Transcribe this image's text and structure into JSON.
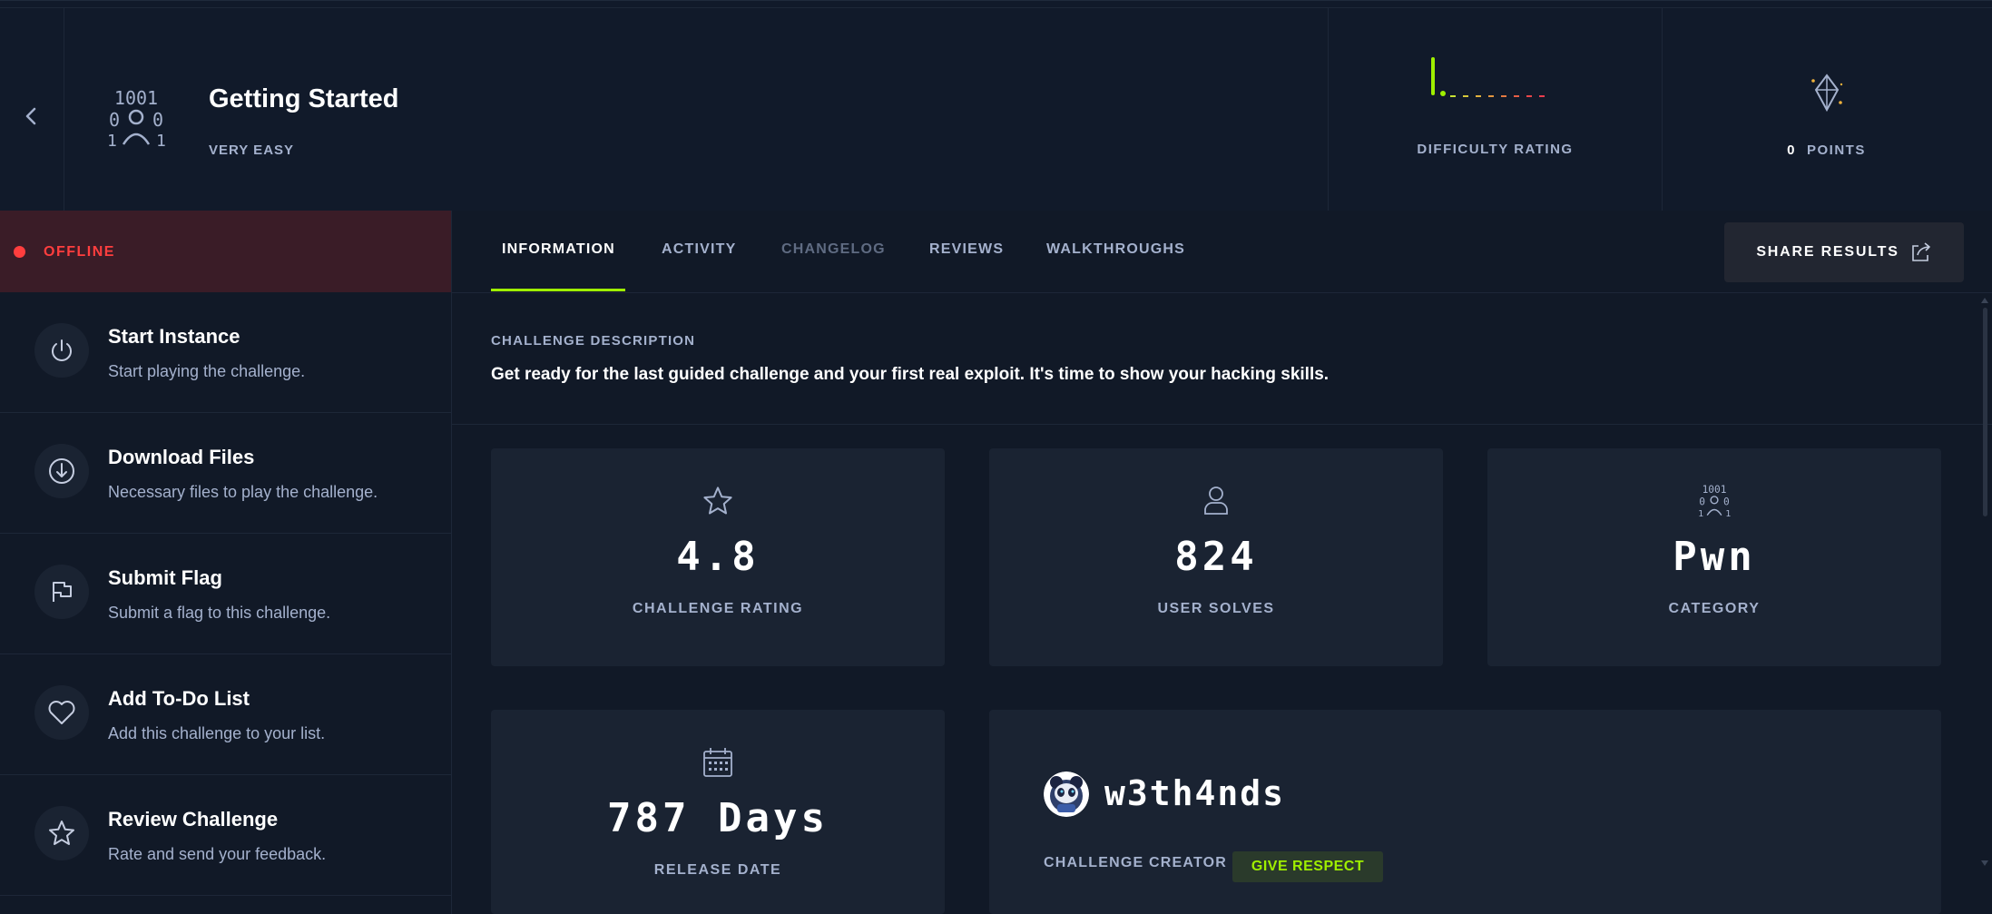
{
  "header": {
    "title": "Getting Started",
    "difficulty": "VERY EASY",
    "difficulty_rating_label": "DIFFICULTY RATING",
    "points_value": "0",
    "points_label": "POINTS"
  },
  "sidebar": {
    "status": "OFFLINE",
    "actions": [
      {
        "title": "Start Instance",
        "subtitle": "Start playing the challenge."
      },
      {
        "title": "Download Files",
        "subtitle": "Necessary files to play the challenge."
      },
      {
        "title": "Submit Flag",
        "subtitle": "Submit a flag to this challenge."
      },
      {
        "title": "Add To-Do List",
        "subtitle": "Add this challenge to your list."
      },
      {
        "title": "Review Challenge",
        "subtitle": "Rate and send your feedback."
      }
    ]
  },
  "tabs": [
    "INFORMATION",
    "ACTIVITY",
    "CHANGELOG",
    "REVIEWS",
    "WALKTHROUGHS"
  ],
  "share_button": "SHARE RESULTS",
  "description": {
    "heading": "CHALLENGE DESCRIPTION",
    "text": "Get ready for the last guided challenge and your first real exploit. It's time to show your hacking skills."
  },
  "stats": {
    "rating": {
      "value": "4.8",
      "label": "CHALLENGE RATING"
    },
    "solves": {
      "value": "824",
      "label": "USER SOLVES"
    },
    "category": {
      "value": "Pwn",
      "label": "CATEGORY"
    },
    "release": {
      "value": "787 Days",
      "label": "RELEASE DATE"
    }
  },
  "creator": {
    "name": "w3th4nds",
    "label": "CHALLENGE CREATOR",
    "respect_button": "GIVE RESPECT"
  },
  "colors": {
    "accent": "#9fef00",
    "offline": "#ff3e3e",
    "muted": "#a4b1cd"
  }
}
